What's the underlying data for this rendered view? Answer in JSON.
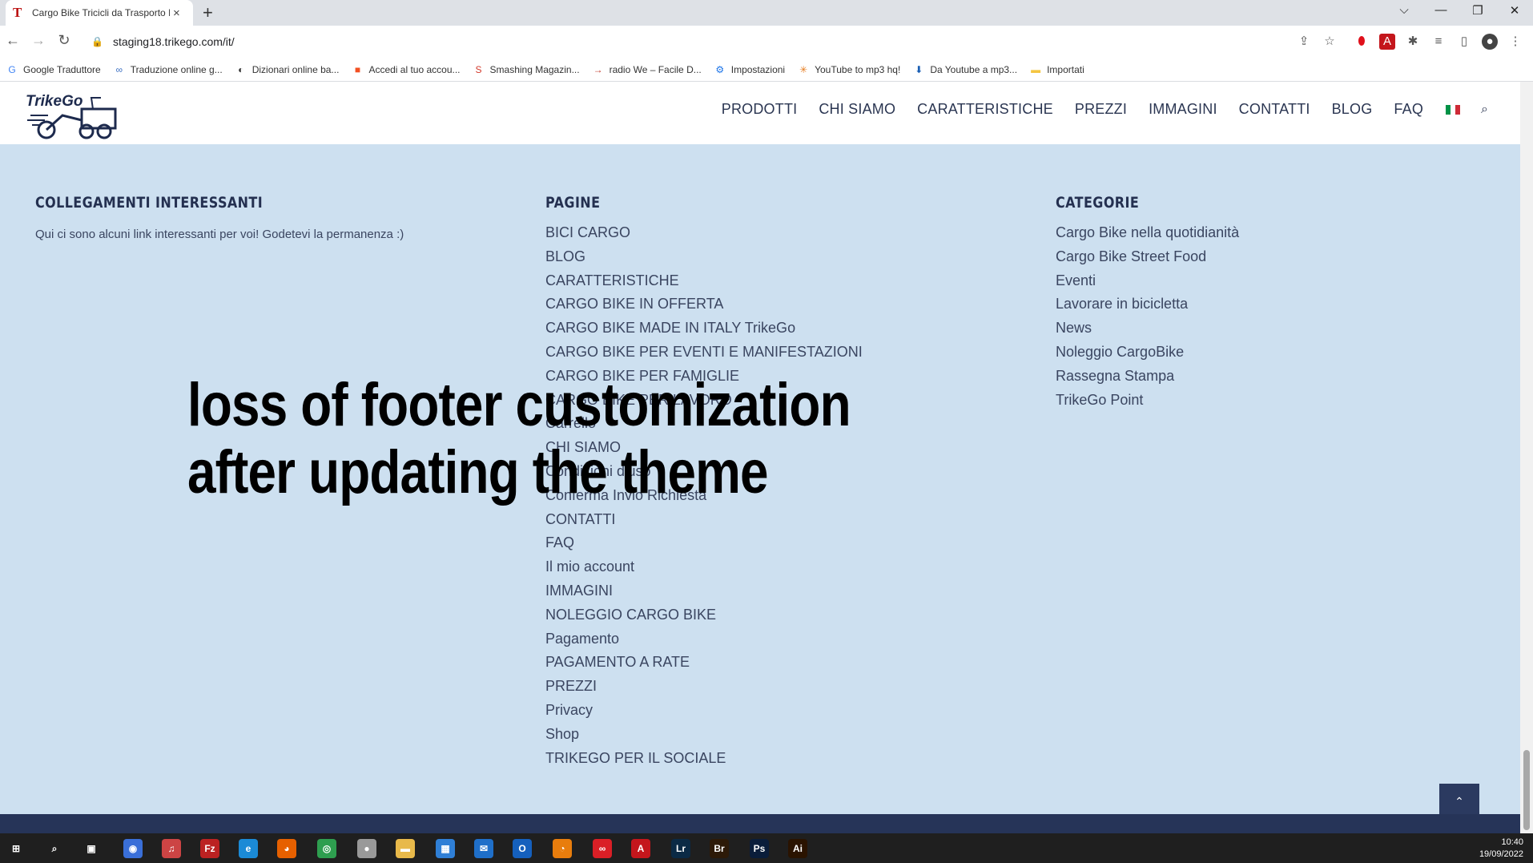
{
  "browser": {
    "tab_title": "Cargo Bike Tricicli da Trasporto B",
    "url": "staging18.trikego.com/it/",
    "new_tab": "+",
    "tab_close": "×",
    "win_min": "—",
    "win_restore": "❐",
    "win_close": "✕",
    "win_tabsearch": "⌵"
  },
  "bookmarks": [
    {
      "label": "Google Traduttore",
      "icon": "google-translate-icon",
      "glyph": "G",
      "color": "#4285f4"
    },
    {
      "label": "Traduzione online g...",
      "icon": "infinity-icon",
      "glyph": "∞",
      "color": "#3b6fc2"
    },
    {
      "label": "Dizionari online ba...",
      "icon": "dictionary-icon",
      "glyph": "◐",
      "color": "#333333"
    },
    {
      "label": "Accedi al tuo accou...",
      "icon": "microsoft-icon",
      "glyph": "■",
      "color": "#f25022"
    },
    {
      "label": "Smashing Magazin...",
      "icon": "smashing-icon",
      "glyph": "S",
      "color": "#d33a2c"
    },
    {
      "label": "radio We – Facile D...",
      "icon": "radio-icon",
      "glyph": "→",
      "color": "#c0392b"
    },
    {
      "label": "Impostazioni",
      "icon": "gear-icon",
      "glyph": "⚙",
      "color": "#1a73e8"
    },
    {
      "label": "YouTube to mp3 hq!",
      "icon": "spark-icon",
      "glyph": "✳",
      "color": "#e67e22"
    },
    {
      "label": "Da Youtube a mp3...",
      "icon": "download-icon",
      "glyph": "⬇",
      "color": "#1a5fb4"
    },
    {
      "label": "Importati",
      "icon": "folder-icon",
      "glyph": "▬",
      "color": "#f4c542"
    }
  ],
  "site": {
    "logo_text": "TrikeGo",
    "nav": [
      "PRODOTTI",
      "CHI SIAMO",
      "CARATTERISTICHE",
      "PREZZI",
      "IMMAGINI",
      "CONTATTI",
      "BLOG",
      "FAQ"
    ],
    "search_glyph": "⌕"
  },
  "footer": {
    "col1": {
      "title": "COLLEGAMENTI INTERESSANTI",
      "text": "Qui ci sono alcuni link interessanti per voi! Godetevi la permanenza :)"
    },
    "col2": {
      "title": "PAGINE",
      "links": [
        "BICI CARGO",
        "BLOG",
        "CARATTERISTICHE",
        "CARGO BIKE IN OFFERTA",
        "CARGO BIKE MADE IN ITALY TrikeGo",
        "CARGO BIKE PER EVENTI E MANIFESTAZIONI",
        "CARGO BIKE PER FAMIGLIE",
        "CARGO BIKE PER LAVORO",
        "Carrello",
        "CHI SIAMO",
        "Condizioni d'uso",
        "Conferma Invio Richiesta",
        "CONTATTI",
        "FAQ",
        "Il mio account",
        "IMMAGINI",
        "NOLEGGIO CARGO BIKE",
        "Pagamento",
        "PAGAMENTO A RATE",
        "PREZZI",
        "Privacy",
        "Shop",
        "TRIKEGO PER IL SOCIALE"
      ]
    },
    "col3": {
      "title": "CATEGORIE",
      "links": [
        "Cargo Bike nella quotidianità",
        "Cargo Bike Street Food",
        "Eventi",
        "Lavorare in bicicletta",
        "News",
        "Noleggio CargoBike",
        "Rassegna Stampa",
        "TrikeGo Point"
      ]
    }
  },
  "overlay": {
    "line1": "loss of footer customization",
    "line2": "after updating the theme"
  },
  "scroll_top_glyph": "⌃",
  "taskbar": {
    "time": "10:40",
    "date": "19/09/2022",
    "apps": [
      {
        "name": "start-icon",
        "glyph": "⊞",
        "color": "transparent"
      },
      {
        "name": "search-icon",
        "glyph": "⌕",
        "color": "transparent"
      },
      {
        "name": "task-view-icon",
        "glyph": "▣",
        "color": "transparent"
      },
      {
        "name": "app-icon",
        "glyph": "◉",
        "color": "#3a6fd8"
      },
      {
        "name": "music-icon",
        "glyph": "♫",
        "color": "#c44"
      },
      {
        "name": "filezilla-icon",
        "glyph": "Fz",
        "color": "#b22"
      },
      {
        "name": "edge-icon",
        "glyph": "e",
        "color": "#1b8ad6"
      },
      {
        "name": "firefox-icon",
        "glyph": "◕",
        "color": "#e66000"
      },
      {
        "name": "chrome-icon",
        "glyph": "◎",
        "color": "#2e9e4f"
      },
      {
        "name": "circle-icon",
        "glyph": "●",
        "color": "#999"
      },
      {
        "name": "explorer-icon",
        "glyph": "▬",
        "color": "#e8b94a"
      },
      {
        "name": "store-icon",
        "glyph": "▦",
        "color": "#2f7fd6"
      },
      {
        "name": "mail-icon",
        "glyph": "✉",
        "color": "#1f6fc9"
      },
      {
        "name": "outlook-icon",
        "glyph": "O",
        "color": "#1560bd"
      },
      {
        "name": "blender-icon",
        "glyph": "◔",
        "color": "#e87d0d"
      },
      {
        "name": "creative-cloud-icon",
        "glyph": "∞",
        "color": "#da1f26"
      },
      {
        "name": "acrobat-icon",
        "glyph": "A",
        "color": "#c4161c"
      },
      {
        "name": "lightroom-icon",
        "glyph": "Lr",
        "color": "#0b2a45"
      },
      {
        "name": "bridge-icon",
        "glyph": "Br",
        "color": "#2d1a08"
      },
      {
        "name": "photoshop-icon",
        "glyph": "Ps",
        "color": "#0a1d3a"
      },
      {
        "name": "illustrator-icon",
        "glyph": "Ai",
        "color": "#2a1300"
      }
    ]
  },
  "colors": {
    "footer_bg": "#cde0f0",
    "footer_text": "#3a4560",
    "heading": "#243050",
    "nav_text": "#2b3652"
  }
}
